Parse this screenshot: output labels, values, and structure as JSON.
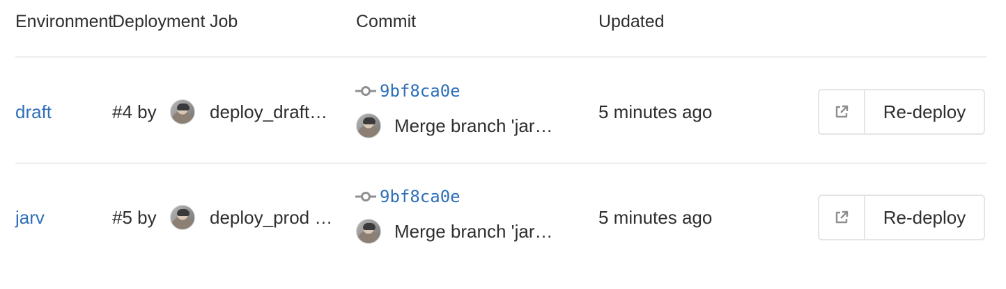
{
  "table": {
    "headers": {
      "environment": "Environment",
      "deployment": "Deployment",
      "job": "Job",
      "commit": "Commit",
      "updated": "Updated"
    },
    "rows": [
      {
        "environment": "draft",
        "deployment": "#4 by",
        "job": "deploy_draft…",
        "commit_sha": "9bf8ca0e",
        "commit_title": "Merge branch 'jar…",
        "updated": "5 minutes ago",
        "redeploy_label": "Re-deploy"
      },
      {
        "environment": "jarv",
        "deployment": "#5 by",
        "job": "deploy_prod …",
        "commit_sha": "9bf8ca0e",
        "commit_title": "Merge branch 'jar…",
        "updated": "5 minutes ago",
        "redeploy_label": "Re-deploy"
      }
    ]
  },
  "icons": {
    "commit": "commit-icon",
    "external_link": "external-link-icon",
    "avatar": "user-avatar"
  },
  "colors": {
    "link": "#2e6fb8",
    "text": "#2e2e2e",
    "divider": "#eeeeee",
    "button_border": "#e5e5e5",
    "icon": "#8f8f8f"
  }
}
